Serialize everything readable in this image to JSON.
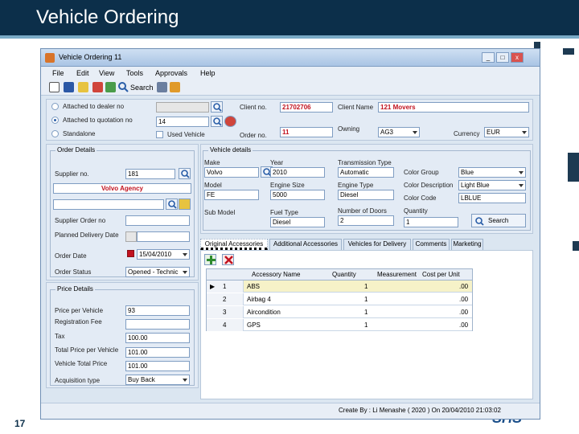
{
  "slide": {
    "title": "Vehicle Ordering",
    "page_number": "17",
    "logo_text": "SHS"
  },
  "window": {
    "title": "Vehicle Ordering 11",
    "min": "_",
    "max": "□",
    "close": "x"
  },
  "menu": [
    "File",
    "Edit",
    "View",
    "Tools",
    "Approvals",
    "Help"
  ],
  "toolbar": {
    "search_label": "Search"
  },
  "top": {
    "attached_to_dealer": "Attached to dealer no",
    "attached_to_quotation": "Attached to quotation no",
    "standalone": "Standalone",
    "quotation_value": "14",
    "used_vehicle": "Used Vehicle",
    "client_no_label": "Client no.",
    "client_no": "21702706",
    "client_name_label": "Client Name",
    "client_name": "121 Movers",
    "order_no_label": "Order no.",
    "order_no": "11",
    "owning_label": "Owning",
    "owning_value": "AG3",
    "currency_label": "Currency",
    "currency_value": "EUR"
  },
  "order_details": {
    "legend": "Order Details",
    "supplier_no_label": "Supplier no.",
    "supplier_no": "181",
    "agency_button": "Volvo Agency",
    "supplier_order_no_label": "Supplier Order no",
    "planned_delivery_label": "Planned Delivery Date",
    "order_date_label": "Order Date",
    "order_date": "15/04/2010",
    "order_status_label": "Order Status",
    "order_status": "Opened - Technic"
  },
  "price_details": {
    "legend": "Price Details",
    "price_per_vehicle_label": "Price per Vehicle",
    "price_per_vehicle": "93",
    "registration_fee_label": "Registration Fee",
    "registration_fee": "",
    "tax_label": "Tax",
    "tax": "100.00",
    "total_price_label": "Total Price per Vehicle",
    "total_price": "101.00",
    "vehicle_total_label": "Vehicle Total Price",
    "vehicle_total": "101.00",
    "acquisition_type_label": "Acquisition type",
    "acquisition_type": "Buy Back"
  },
  "vehicle_details": {
    "legend": "Vehicle details",
    "make_label": "Make",
    "make": "Volvo",
    "year_label": "Year",
    "year": "2010",
    "transmission_label": "Transmission Type",
    "transmission": "Automatic",
    "color_group_label": "Color Group",
    "color_group": "Blue",
    "model_label": "Model",
    "model": "FE",
    "engine_size_label": "Engine Size",
    "engine_size": "5000",
    "engine_type_label": "Engine Type",
    "engine_type": "Diesel",
    "color_description_label": "Color Description",
    "color_description": "Light Blue",
    "color_code_label": "Color Code",
    "color_code": "LBLUE",
    "sub_model_label": "Sub Model",
    "fuel_type_label": "Fuel Type",
    "fuel_type": "Diesel",
    "doors_label": "Number of Doors",
    "doors": "2",
    "quantity_label": "Quantity",
    "quantity": "1",
    "search_button": "Search"
  },
  "tabs": [
    "Original Accessories",
    "Additional Accessories",
    "Vehicles for Delivery",
    "Comments",
    "Marketing"
  ],
  "grid": {
    "headers": [
      "Accessory Name",
      "Quantity",
      "Measurement",
      "Cost per Unit"
    ],
    "rows": [
      {
        "num": "1",
        "name": "ABS",
        "qty": "1",
        "meas": "",
        "cost": ".00"
      },
      {
        "num": "2",
        "name": "Airbag 4",
        "qty": "1",
        "meas": "",
        "cost": ".00"
      },
      {
        "num": "3",
        "name": "Aircondition",
        "qty": "1",
        "meas": "",
        "cost": ".00"
      },
      {
        "num": "4",
        "name": "GPS",
        "qty": "1",
        "meas": "",
        "cost": ".00"
      }
    ],
    "current_marker": "▶"
  },
  "status": {
    "text": "Create By : Li Menashe ( 2020 ) On 20/04/2010 21:03:02"
  }
}
